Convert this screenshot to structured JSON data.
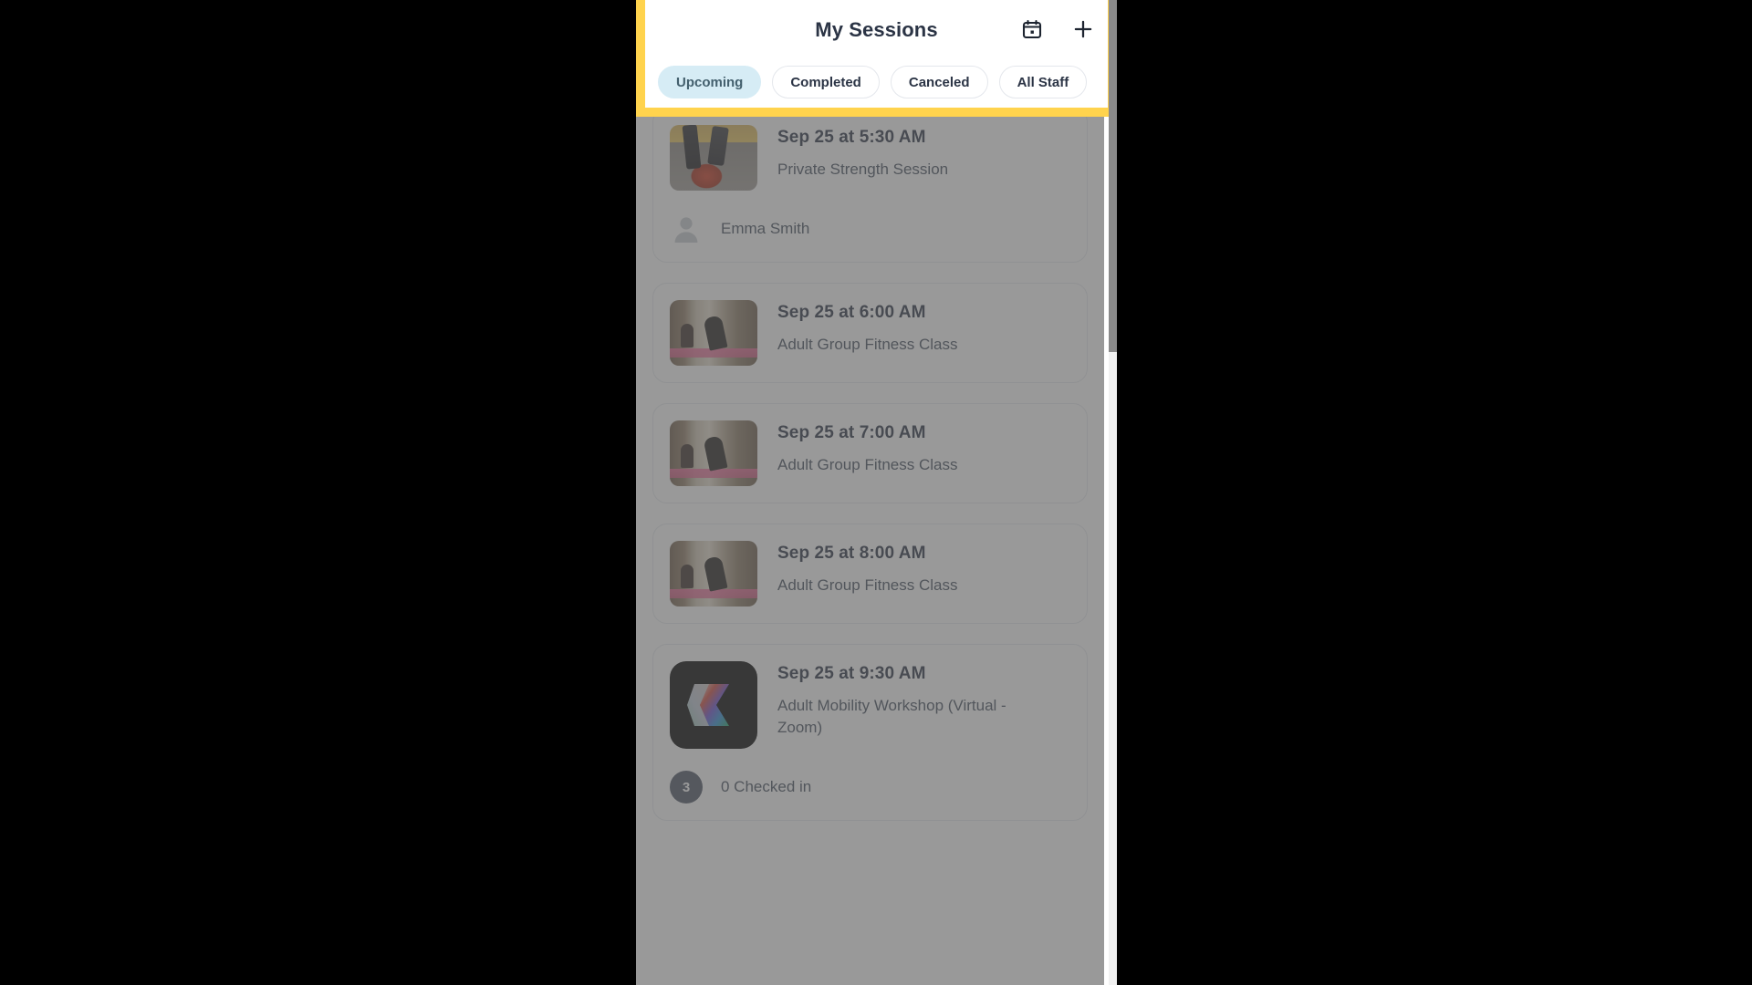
{
  "header": {
    "title": "My Sessions",
    "calendar_icon": "calendar-icon",
    "add_icon": "plus-icon",
    "highlight_color": "#ffd34d"
  },
  "tabs": [
    {
      "label": "Upcoming",
      "active": true
    },
    {
      "label": "Completed",
      "active": false
    },
    {
      "label": "Canceled",
      "active": false
    },
    {
      "label": "All Staff",
      "active": false
    }
  ],
  "sessions": [
    {
      "time": "Sep 25 at 5:30 AM",
      "name": "Private Strength Session",
      "thumb": "kettlebell-photo",
      "footer": {
        "kind": "avatar",
        "icon": "person-avatar-icon",
        "label": "Emma Smith"
      }
    },
    {
      "time": "Sep 25 at 6:00 AM",
      "name": "Adult Group Fitness Class",
      "thumb": "yoga-class-photo",
      "footer": null
    },
    {
      "time": "Sep 25 at 7:00 AM",
      "name": "Adult Group Fitness Class",
      "thumb": "yoga-class-photo",
      "footer": null
    },
    {
      "time": "Sep 25 at 8:00 AM",
      "name": "Adult Group Fitness Class",
      "thumb": "yoga-class-photo",
      "footer": null
    },
    {
      "time": "Sep 25 at 9:30 AM",
      "name": "Adult Mobility Workshop (Virtual - Zoom)",
      "thumb": "zoom-app-icon",
      "footer": {
        "kind": "badge",
        "count": "3",
        "label": "0 Checked in"
      }
    }
  ],
  "colors": {
    "active_tab_bg": "#d6ecf5",
    "active_tab_text": "#44606e",
    "title_text": "#2b3445",
    "badge_bg": "#4c5565"
  }
}
